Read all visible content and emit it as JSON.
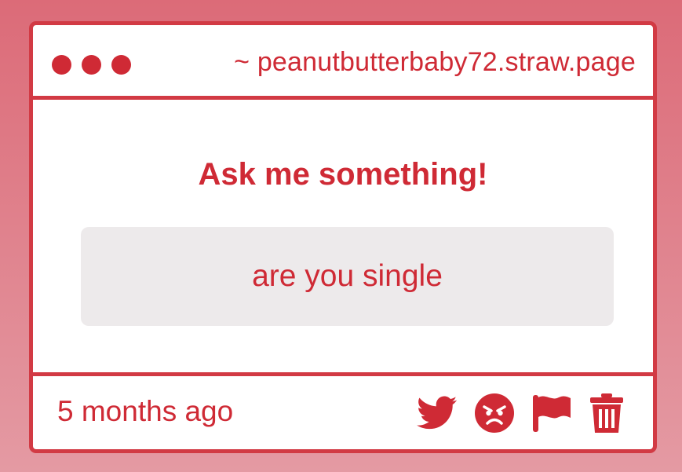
{
  "window": {
    "controls": [
      "dot-red",
      "dot-red",
      "dot-red"
    ],
    "url": "~ peanutbutterbaby72.straw.page"
  },
  "main": {
    "heading": "Ask me something!",
    "question": "are you single"
  },
  "footer": {
    "timestamp": "5 months ago",
    "actions": [
      "twitter-icon",
      "angry-face-icon",
      "flag-icon",
      "trash-icon"
    ]
  },
  "colors": {
    "accent": "#cf2a35",
    "border": "#d23a44",
    "question_bg": "#edeaeb",
    "background_top": "#dc6b78",
    "background_bottom": "#e49aa3"
  }
}
